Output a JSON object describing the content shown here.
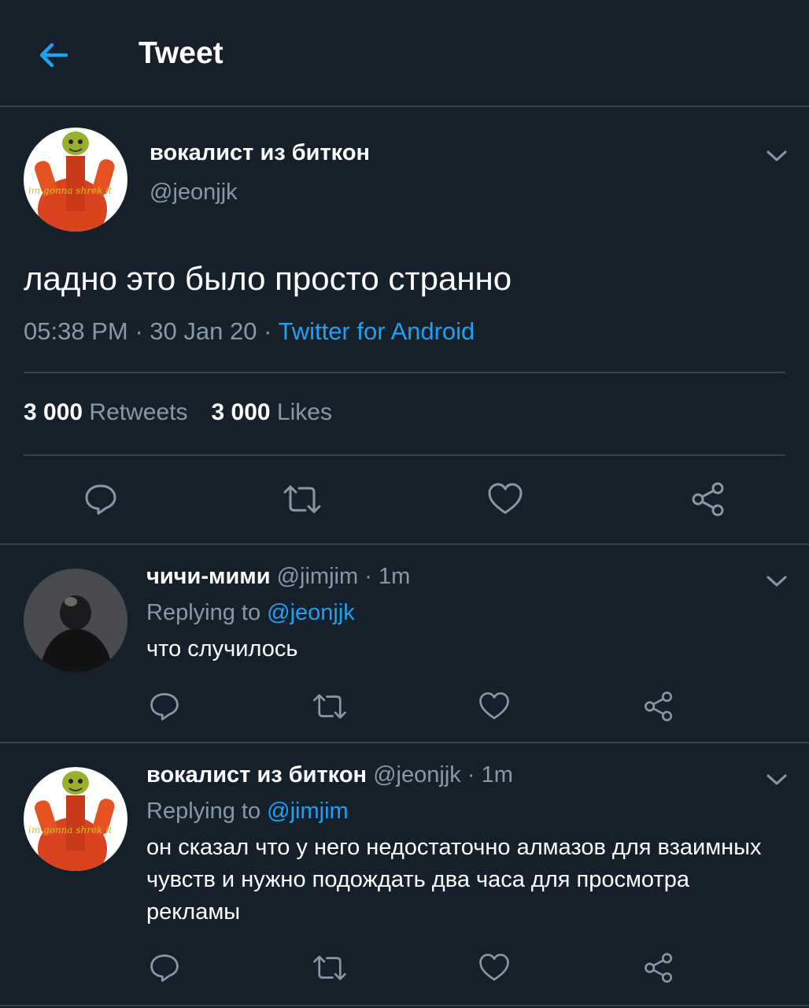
{
  "header": {
    "title": "Tweet",
    "back_icon": "arrow-left-icon"
  },
  "colors": {
    "background": "#15202b",
    "accent": "#1da1f2",
    "muted": "#8899a6",
    "divider": "#38444d"
  },
  "main_tweet": {
    "author_name": "вокалист из биткон",
    "handle": "@jeonjjk",
    "avatar_caption": "im gonna shrek it",
    "text": "ладно это было просто странно",
    "time": "05:38 PM",
    "date": "30 Jan 20",
    "source": "Twitter for Android",
    "retweets_count": "3 000",
    "retweets_label": "Retweets",
    "likes_count": "3 000",
    "likes_label": "Likes"
  },
  "replies": [
    {
      "author_name": "чичи-мими",
      "handle": "@jimjim",
      "time": "1m",
      "replying_label": "Replying to",
      "replying_to": "@jeonjjk",
      "text": "что случилось"
    },
    {
      "author_name": "вокалист из биткон",
      "handle": "@jeonjjk",
      "time": "1m",
      "replying_label": "Replying to",
      "replying_to": "@jimjim",
      "avatar_caption": "im gonna shrek it",
      "text": "он сказал что у него недостаточно алмазов для взаимных чувств и нужно подождать два часа для просмотра рекламы"
    }
  ],
  "separator": "·"
}
